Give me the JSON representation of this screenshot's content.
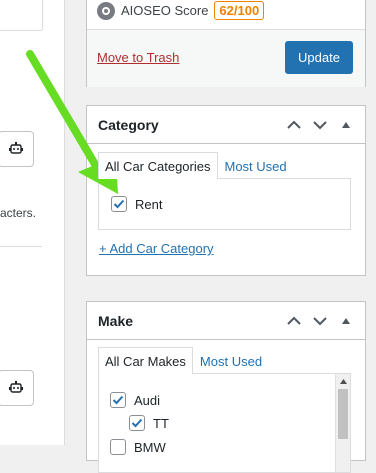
{
  "left_panel": {
    "text_fragment": "acters.",
    "icons": [
      "robot-icon",
      "robot-icon"
    ]
  },
  "publish": {
    "seo_label": "AIOSEO Score",
    "seo_score": "62/100",
    "trash_label": "Move to Trash",
    "update_label": "Update"
  },
  "category": {
    "title": "Category",
    "tabs": [
      "All Car Categories",
      "Most Used"
    ],
    "items": [
      {
        "label": "Rent",
        "checked": true
      }
    ],
    "add_link": "+ Add Car Category"
  },
  "make": {
    "title": "Make",
    "tabs": [
      "All Car Makes",
      "Most Used"
    ],
    "items": [
      {
        "label": "Audi",
        "checked": true
      },
      {
        "label": "TT",
        "checked": true
      },
      {
        "label": "BMW",
        "checked": false
      }
    ]
  },
  "colors": {
    "accent": "#2271b1",
    "danger": "#b32d2e",
    "score": "#f18200",
    "arrow": "#66dd22"
  }
}
